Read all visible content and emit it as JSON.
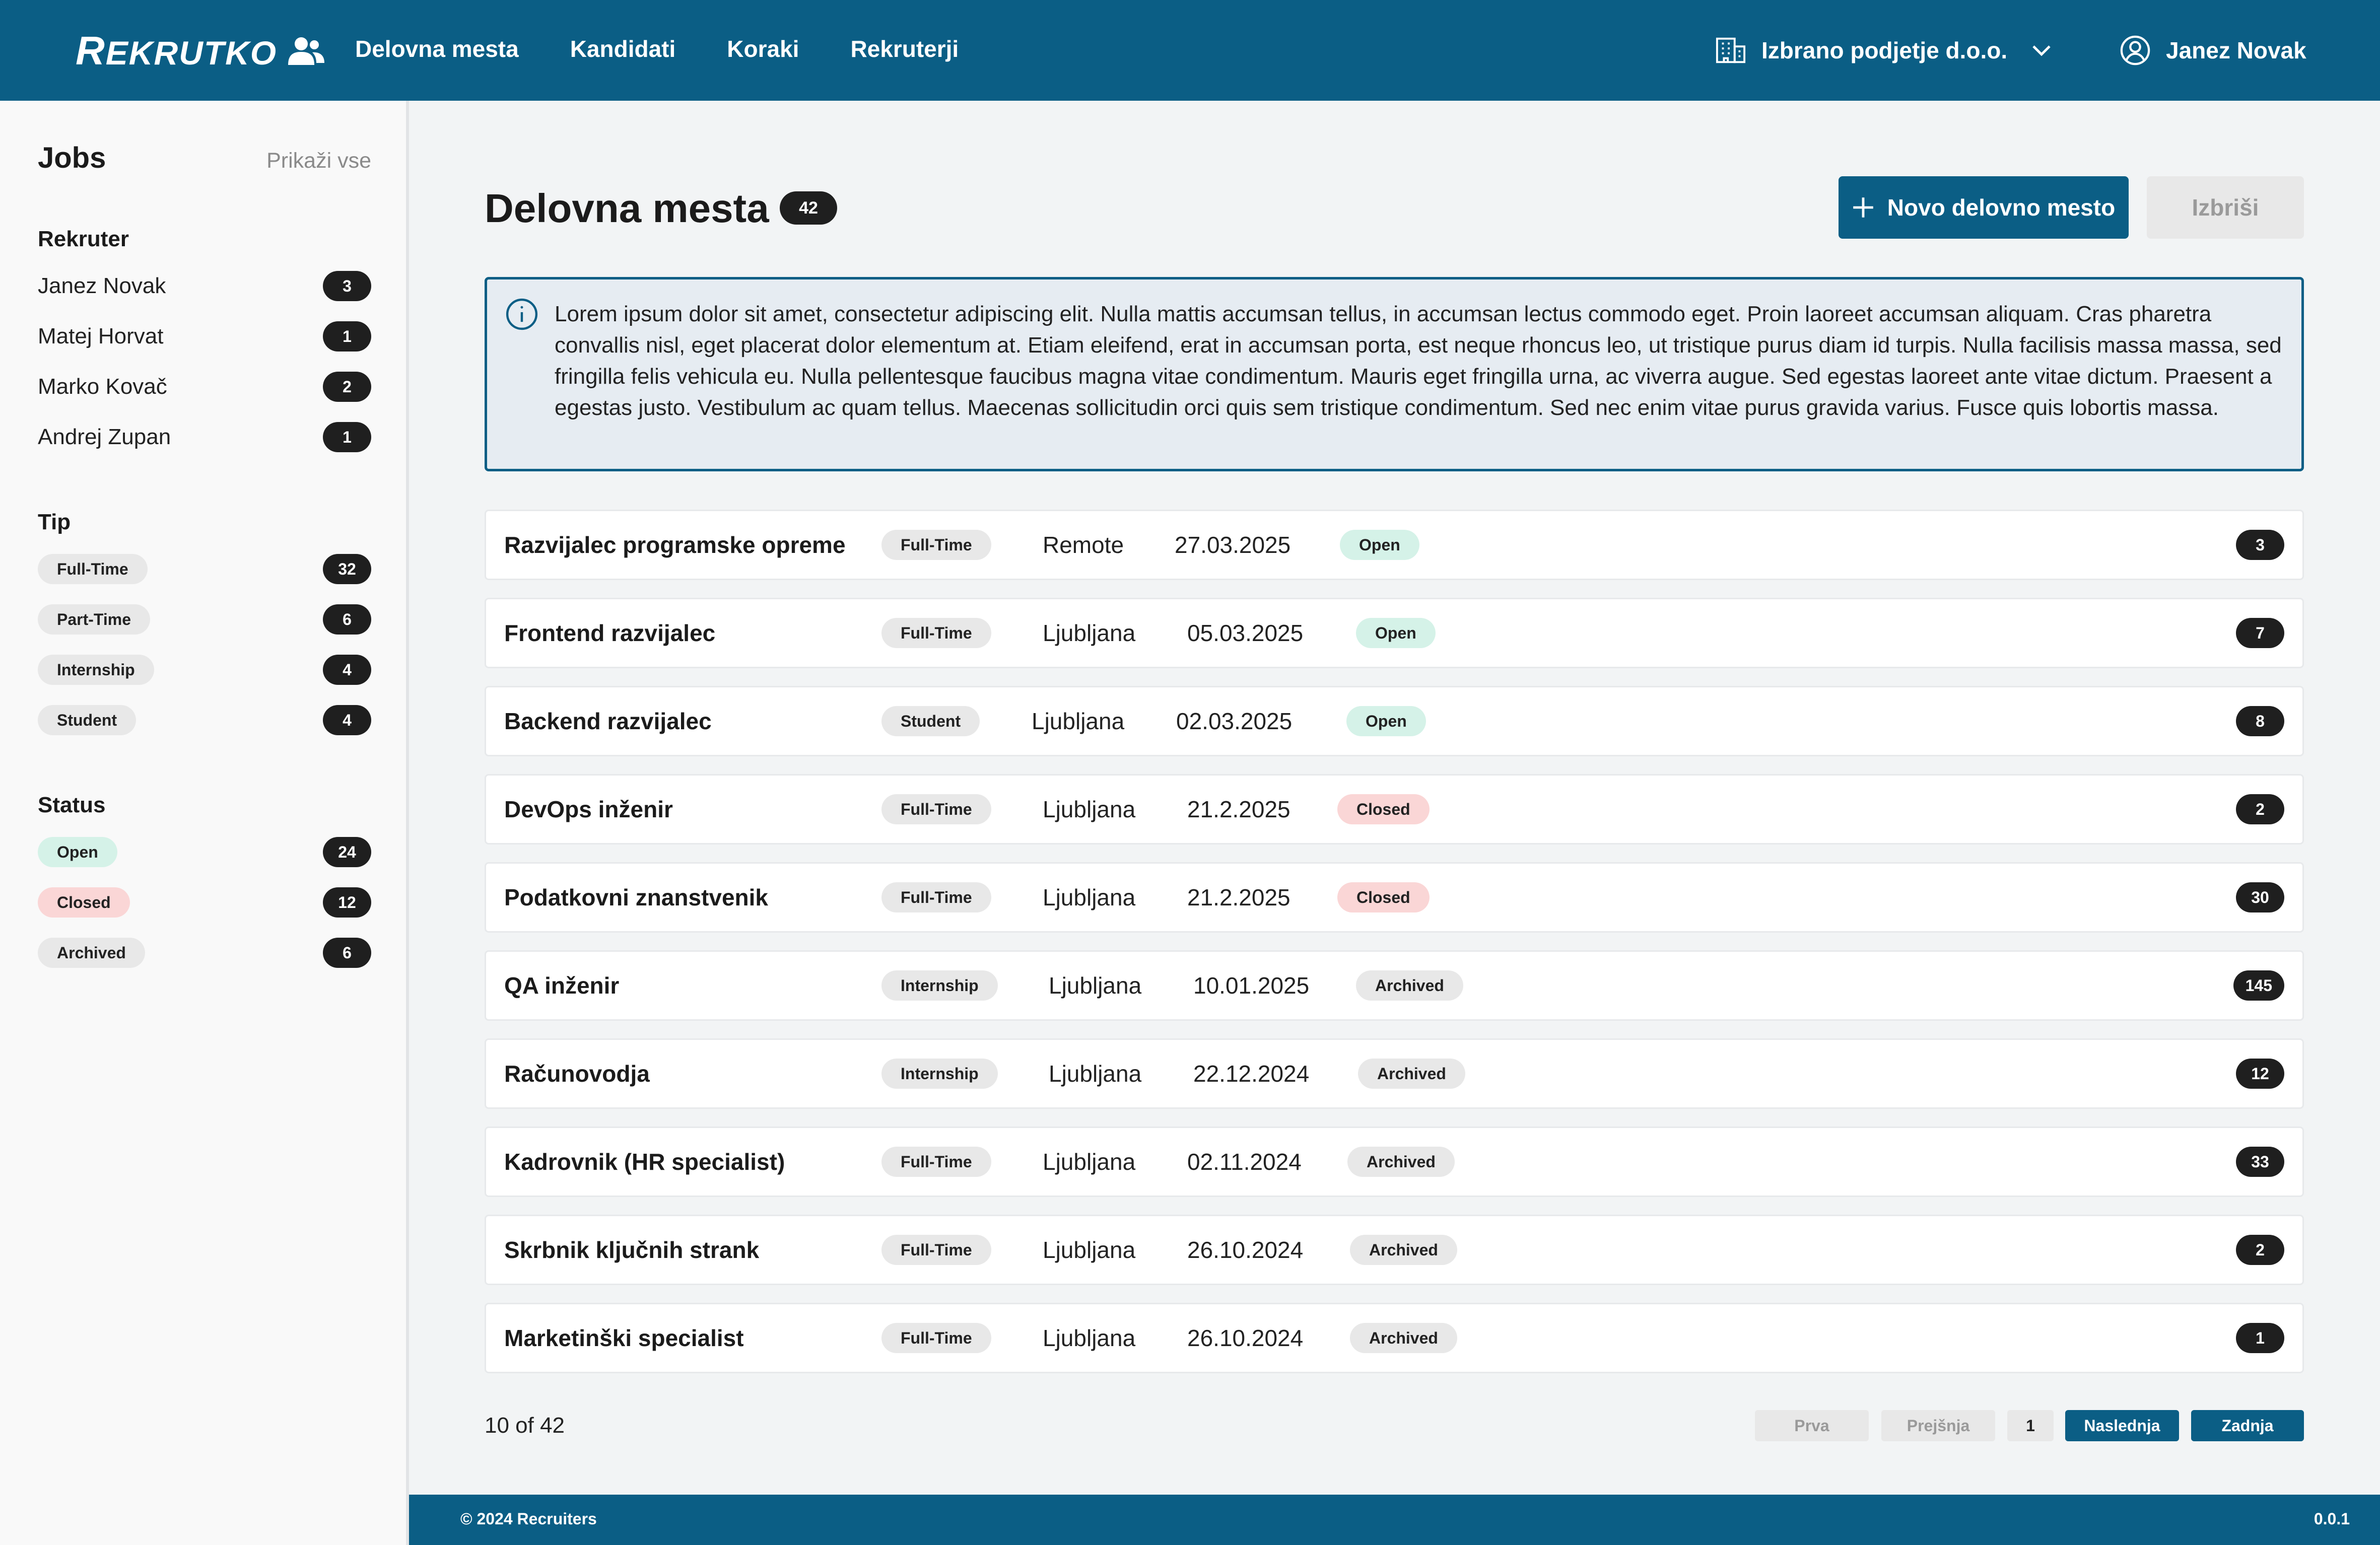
{
  "brand": {
    "logo_text_first": "R",
    "logo_text_rest": "EKRUTKO",
    "icon": "users-icon"
  },
  "nav": {
    "items": [
      "Delovna mesta",
      "Kandidati",
      "Koraki",
      "Rekruterji"
    ]
  },
  "header": {
    "company": "Izbrano podjetje d.o.o.",
    "company_icon": "building-icon",
    "user": "Janez Novak",
    "user_icon": "user-circle-icon"
  },
  "sidebar": {
    "title": "Jobs",
    "show_all": "Prikaži vse",
    "recruiter": {
      "heading": "Rekruter",
      "items": [
        {
          "label": "Janez Novak",
          "count": "3"
        },
        {
          "label": "Matej Horvat",
          "count": "1"
        },
        {
          "label": "Marko Kovač",
          "count": "2"
        },
        {
          "label": "Andrej Zupan",
          "count": "1"
        }
      ]
    },
    "type": {
      "heading": "Tip",
      "items": [
        {
          "label": "Full-Time",
          "count": "32"
        },
        {
          "label": "Part-Time",
          "count": "6"
        },
        {
          "label": "Internship",
          "count": "4"
        },
        {
          "label": "Student",
          "count": "4"
        }
      ]
    },
    "status": {
      "heading": "Status",
      "items": [
        {
          "label": "Open",
          "count": "24",
          "kind": "open"
        },
        {
          "label": "Closed",
          "count": "12",
          "kind": "closed"
        },
        {
          "label": "Archived",
          "count": "6",
          "kind": "archived"
        }
      ]
    }
  },
  "main": {
    "title": "Delovna mesta",
    "total": "42",
    "new_button": "Novo delovno mesto",
    "delete_button": "Izbriši",
    "info": "Lorem ipsum dolor sit amet, consectetur adipiscing elit. Nulla mattis accumsan tellus, in accumsan lectus commodo eget. Proin laoreet accumsan aliquam. Cras pharetra convallis nisl, eget placerat dolor elementum at. Etiam eleifend, erat in accumsan porta, est neque rhoncus leo, ut tristique purus diam id turpis. Nulla facilisis massa massa, sed fringilla felis vehicula eu. Nulla pellentesque faucibus magna vitae condimentum. Mauris eget fringilla urna, ac viverra augue. Sed egestas laoreet ante vitae dictum. Praesent a egestas justo. Vestibulum ac quam tellus. Maecenas sollicitudin orci quis sem tristique condimentum. Sed nec enim vitae purus gravida varius. Fusce quis lobortis massa.",
    "jobs": [
      {
        "title": "Razvijalec programske opreme",
        "type": "Full-Time",
        "location": "Remote",
        "date": "27.03.2025",
        "status": "Open",
        "status_kind": "open",
        "count": "3"
      },
      {
        "title": "Frontend razvijalec",
        "type": "Full-Time",
        "location": "Ljubljana",
        "date": "05.03.2025",
        "status": "Open",
        "status_kind": "open",
        "count": "7"
      },
      {
        "title": "Backend razvijalec",
        "type": "Student",
        "location": "Ljubljana",
        "date": "02.03.2025",
        "status": "Open",
        "status_kind": "open",
        "count": "8"
      },
      {
        "title": "DevOps inženir",
        "type": "Full-Time",
        "location": "Ljubljana",
        "date": "21.2.2025",
        "status": "Closed",
        "status_kind": "closed",
        "count": "2"
      },
      {
        "title": "Podatkovni znanstvenik",
        "type": "Full-Time",
        "location": "Ljubljana",
        "date": "21.2.2025",
        "status": "Closed",
        "status_kind": "closed",
        "count": "30"
      },
      {
        "title": "QA inženir",
        "type": "Internship",
        "location": "Ljubljana",
        "date": "10.01.2025",
        "status": "Archived",
        "status_kind": "archived",
        "count": "145"
      },
      {
        "title": "Računovodja",
        "type": "Internship",
        "location": "Ljubljana",
        "date": "22.12.2024",
        "status": "Archived",
        "status_kind": "archived",
        "count": "12"
      },
      {
        "title": "Kadrovnik (HR specialist)",
        "type": "Full-Time",
        "location": "Ljubljana",
        "date": "02.11.2024",
        "status": "Archived",
        "status_kind": "archived",
        "count": "33"
      },
      {
        "title": "Skrbnik ključnih strank",
        "type": "Full-Time",
        "location": "Ljubljana",
        "date": "26.10.2024",
        "status": "Archived",
        "status_kind": "archived",
        "count": "2"
      },
      {
        "title": "Marketinški specialist",
        "type": "Full-Time",
        "location": "Ljubljana",
        "date": "26.10.2024",
        "status": "Archived",
        "status_kind": "archived",
        "count": "1"
      }
    ]
  },
  "pagination": {
    "info": "10 of 42",
    "first": "Prva",
    "prev": "Prejšnja",
    "page": "1",
    "next": "Naslednja",
    "last": "Zadnja"
  },
  "footer": {
    "copyright": "© 2024 Recruiters",
    "version": "0.0.1"
  },
  "colors": {
    "primary": "#0b5e85",
    "open": "#d5f2e8",
    "closed": "#fad6d6",
    "neutral_pill": "#e8e8e8",
    "badge": "#1f1f1f"
  }
}
